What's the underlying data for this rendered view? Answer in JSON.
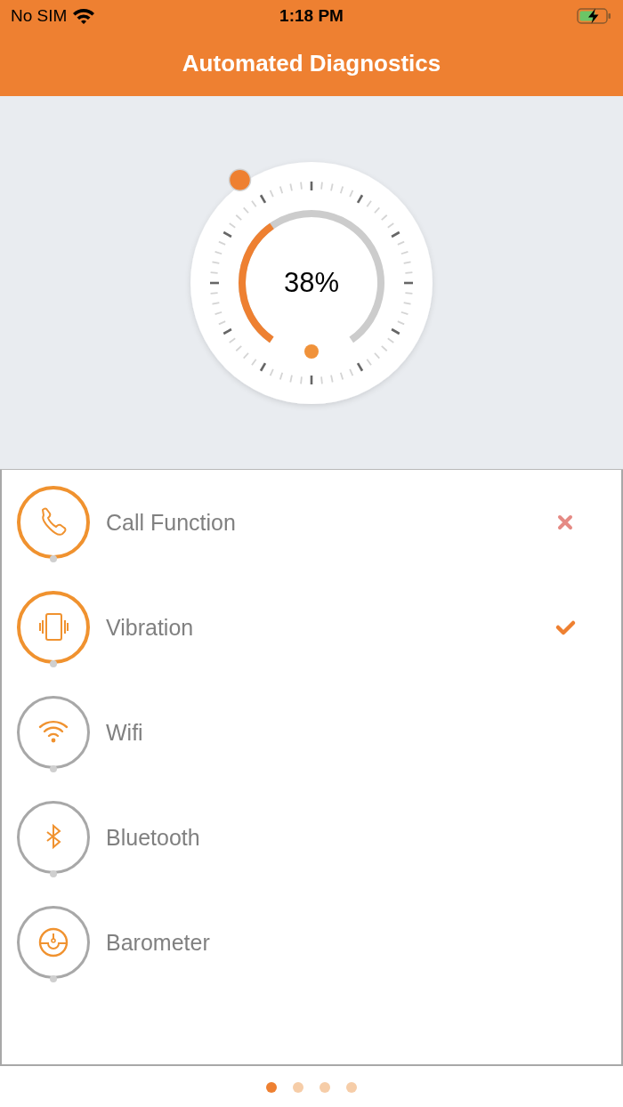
{
  "status_bar": {
    "carrier": "No SIM",
    "time": "1:18 PM"
  },
  "header": {
    "title": "Automated Diagnostics"
  },
  "gauge": {
    "reading": "38%"
  },
  "tests": [
    {
      "kind": "phone",
      "label": "Call Function",
      "done": true,
      "passed": false,
      "failed": true
    },
    {
      "kind": "vibration",
      "label": "Vibration",
      "done": true,
      "passed": true,
      "failed": false
    },
    {
      "kind": "wifi",
      "label": "Wifi",
      "done": false,
      "passed": false,
      "failed": false
    },
    {
      "kind": "bluetooth",
      "label": "Bluetooth",
      "done": false,
      "passed": false,
      "failed": false
    },
    {
      "kind": "barometer",
      "label": "Barometer",
      "done": false,
      "passed": false,
      "failed": false
    }
  ],
  "pages": [
    {
      "selected": true
    },
    {
      "selected": false
    },
    {
      "selected": false
    },
    {
      "selected": false
    }
  ]
}
